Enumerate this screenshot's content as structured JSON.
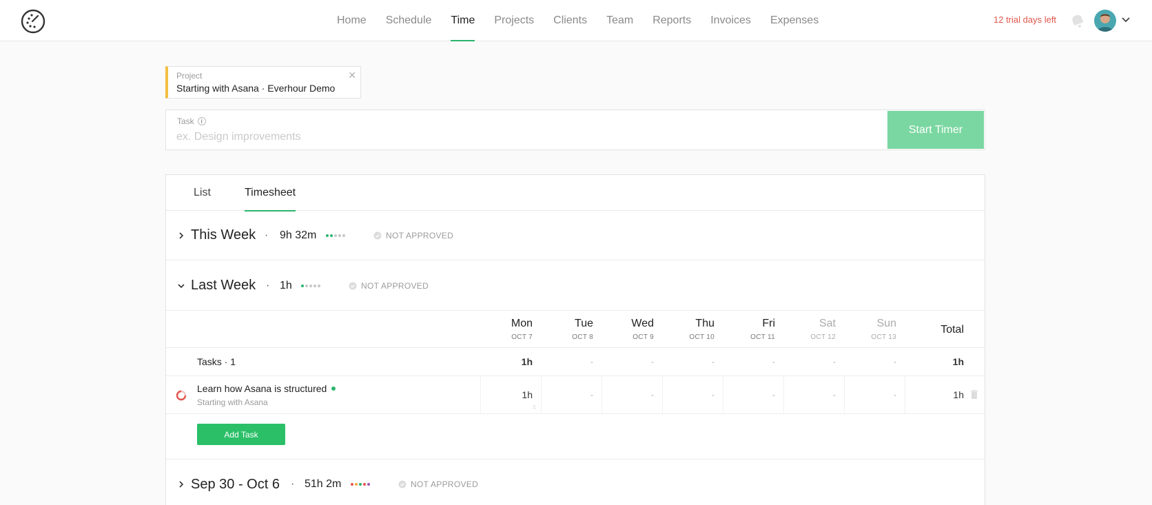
{
  "nav": {
    "items": [
      {
        "label": "Home",
        "active": false
      },
      {
        "label": "Schedule",
        "active": false
      },
      {
        "label": "Time",
        "active": true
      },
      {
        "label": "Projects",
        "active": false
      },
      {
        "label": "Clients",
        "active": false
      },
      {
        "label": "Team",
        "active": false
      },
      {
        "label": "Reports",
        "active": false
      },
      {
        "label": "Invoices",
        "active": false
      },
      {
        "label": "Expenses",
        "active": false
      }
    ],
    "trial_text": "12 trial days left",
    "accent_color": "#2ab56d"
  },
  "project": {
    "label": "Project",
    "name": "Starting with Asana · Everhour Demo"
  },
  "task_entry": {
    "label": "Task",
    "placeholder": "ex. Design improvements",
    "value": "",
    "start_button": "Start Timer"
  },
  "tabs": [
    {
      "label": "List",
      "active": false
    },
    {
      "label": "Timesheet",
      "active": true
    }
  ],
  "weeks": {
    "this_week": {
      "title": "This Week",
      "hours": "9h 32m",
      "status": "NOT APPROVED",
      "expanded": false
    },
    "last_week": {
      "title": "Last Week",
      "hours": "1h",
      "status": "NOT APPROVED",
      "expanded": true
    },
    "sep_week": {
      "title": "Sep 30 - Oct 6",
      "hours": "51h 2m",
      "status": "NOT APPROVED",
      "expanded": false
    }
  },
  "timesheet": {
    "days": [
      {
        "name": "Mon",
        "date": "OCT 7"
      },
      {
        "name": "Tue",
        "date": "OCT 8"
      },
      {
        "name": "Wed",
        "date": "OCT 9"
      },
      {
        "name": "Thu",
        "date": "OCT 10"
      },
      {
        "name": "Fri",
        "date": "OCT 11"
      },
      {
        "name": "Sat",
        "date": "OCT 12"
      },
      {
        "name": "Sun",
        "date": "OCT 13"
      }
    ],
    "total_label": "Total",
    "tasks_count_label": "Tasks · 1",
    "tasks_totals": [
      "1h",
      "-",
      "-",
      "-",
      "-",
      "-",
      "-"
    ],
    "tasks_total": "1h",
    "rows": [
      {
        "name": "Learn how Asana is structured",
        "project": "Starting with Asana",
        "values": [
          "1h",
          "-",
          "-",
          "-",
          "-",
          "-",
          "-"
        ],
        "total": "1h"
      }
    ],
    "add_task_label": "Add Task"
  }
}
